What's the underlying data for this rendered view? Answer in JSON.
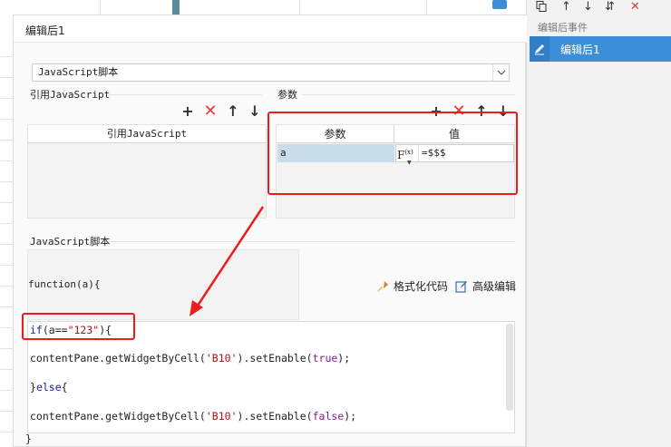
{
  "dialog": {
    "title": "编辑后1",
    "script_type": "JavaScript脚本",
    "ref_section_label": "引用JavaScript",
    "ref_table_header": "引用JavaScript",
    "param_section_label": "参数",
    "param_headers": [
      "参数",
      "值"
    ],
    "params": [
      {
        "name": "a",
        "fx": "F",
        "fx_sup": "(x)",
        "value": "=$$$"
      }
    ],
    "script_section_label": "JavaScript脚本",
    "function_signature": "function(a){",
    "format_code_label": "格式化代码",
    "advanced_edit_label": "高级编辑",
    "code_lines": [
      {
        "tokens": [
          {
            "t": "if",
            "c": "kw"
          },
          {
            "t": "(a==",
            "c": ""
          },
          {
            "t": "\"123\"",
            "c": "str"
          },
          {
            "t": "){",
            "c": ""
          }
        ]
      },
      {
        "tokens": [
          {
            "t": "contentPane.getWidgetByCell(",
            "c": ""
          },
          {
            "t": "'B10'",
            "c": "str"
          },
          {
            "t": ").setEnable(",
            "c": ""
          },
          {
            "t": "true",
            "c": "tok-true"
          },
          {
            "t": ");",
            "c": ""
          }
        ]
      },
      {
        "tokens": [
          {
            "t": "}",
            "c": ""
          },
          {
            "t": "else",
            "c": "kw"
          },
          {
            "t": "{",
            "c": ""
          }
        ]
      },
      {
        "tokens": [
          {
            "t": "contentPane.getWidgetByCell(",
            "c": ""
          },
          {
            "t": "'B10'",
            "c": "str"
          },
          {
            "t": ").setEnable(",
            "c": ""
          },
          {
            "t": "false",
            "c": "tok-true"
          },
          {
            "t": ");",
            "c": ""
          }
        ]
      }
    ],
    "closing_brace": "}"
  },
  "right_panel": {
    "section_title": "编辑后事件",
    "events": [
      {
        "label": "编辑后1",
        "selected": true
      }
    ]
  },
  "icons": {
    "add": "+",
    "delete": "✕",
    "up": "↑",
    "down": "↓"
  },
  "colors": {
    "accent_blue": "#3b8fd9",
    "highlight_red": "#ee1b1b",
    "delete_red": "#e23b3b",
    "param_row_selected": "#c9dcea"
  }
}
